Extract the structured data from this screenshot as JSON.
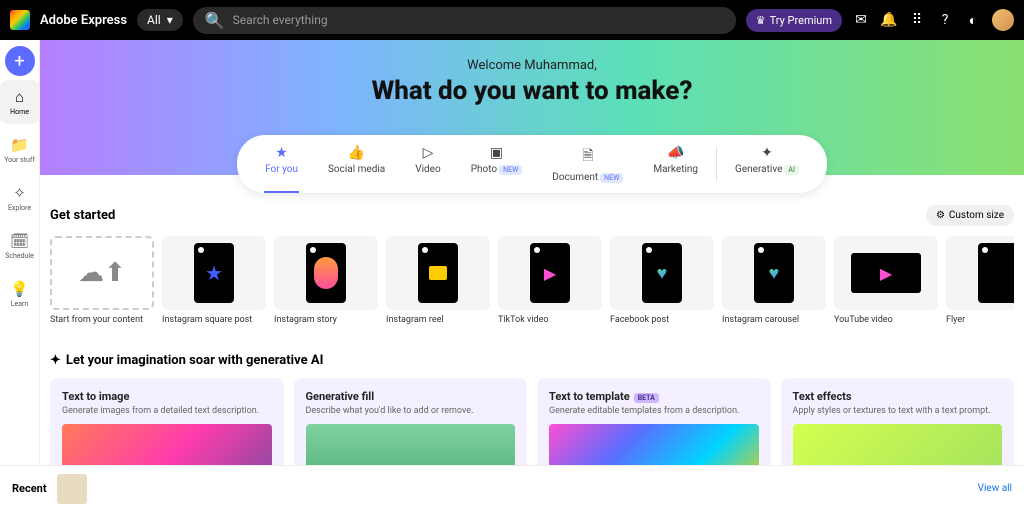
{
  "topbar": {
    "app_name": "Adobe Express",
    "filter_label": "All",
    "search_placeholder": "Search everything",
    "try_premium_label": "Try Premium"
  },
  "sidebar": {
    "items": [
      {
        "label": "Home"
      },
      {
        "label": "Your stuff"
      },
      {
        "label": "Explore"
      },
      {
        "label": "Schedule"
      },
      {
        "label": "Learn"
      }
    ]
  },
  "hero": {
    "welcome": "Welcome Muhammad,",
    "headline": "What do you want to make?"
  },
  "categories": [
    {
      "label": "For you",
      "icon": "★",
      "active": true
    },
    {
      "label": "Social media",
      "icon": "👍"
    },
    {
      "label": "Video",
      "icon": "▷"
    },
    {
      "label": "Photo",
      "icon": "▣",
      "badge": "NEW"
    },
    {
      "label": "Document",
      "icon": "🗎",
      "badge": "NEW"
    },
    {
      "label": "Marketing",
      "icon": "📣"
    },
    {
      "label": "Generative",
      "icon": "✦",
      "badge": "AI",
      "badge_ai": true
    }
  ],
  "get_started": {
    "title": "Get started",
    "custom_size_label": "Custom size",
    "templates": [
      {
        "label": "Start from your content",
        "kind": "upload"
      },
      {
        "label": "Instagram square post",
        "kind": "ig-post"
      },
      {
        "label": "Instagram story",
        "kind": "ig-story"
      },
      {
        "label": "Instagram reel",
        "kind": "ig-reel"
      },
      {
        "label": "TikTok video",
        "kind": "tiktok"
      },
      {
        "label": "Facebook post",
        "kind": "fb"
      },
      {
        "label": "Instagram carousel",
        "kind": "ig-carousel"
      },
      {
        "label": "YouTube video",
        "kind": "yt"
      },
      {
        "label": "Flyer",
        "kind": "flyer"
      }
    ]
  },
  "ai_section": {
    "title": "Let your imagination soar with generative AI",
    "cards": [
      {
        "title": "Text to image",
        "desc": "Generate images from a detailed text description."
      },
      {
        "title": "Generative fill",
        "desc": "Describe what you'd like to add or remove."
      },
      {
        "title": "Text to template",
        "desc": "Generate editable templates from a description.",
        "beta": "BETA"
      },
      {
        "title": "Text effects",
        "desc": "Apply styles or textures to text with a text prompt."
      }
    ]
  },
  "recent": {
    "label": "Recent",
    "view_all": "View all"
  }
}
